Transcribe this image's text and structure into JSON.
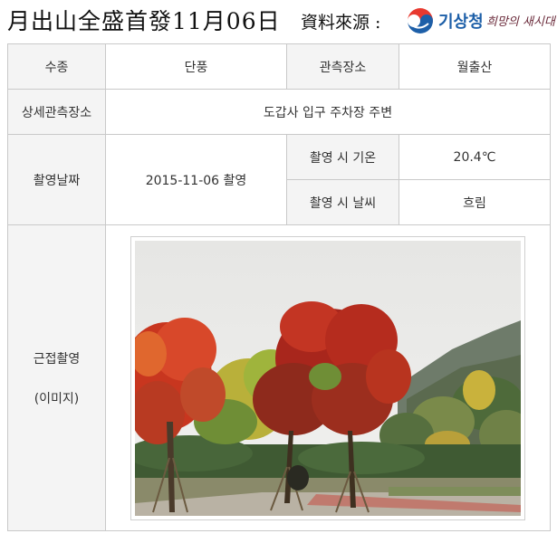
{
  "header": {
    "title": "月出山全盛首發11月06日",
    "source_label": "資料來源 :",
    "agency_name": "기상청",
    "slogan": "희망의 새시대"
  },
  "table": {
    "species_label": "수종",
    "species_value": "단풍",
    "location_label": "관측장소",
    "location_value": "월출산",
    "detail_location_label": "상세관측장소",
    "detail_location_value": "도갑사 입구 주차장 주변",
    "date_label": "촬영날짜",
    "date_value": "2015-11-06 촬영",
    "temp_label": "촬영 시 기온",
    "temp_value": "20.4℃",
    "weather_label": "촬영 시 날씨",
    "weather_value": "흐림",
    "photo_label": "근접촬영",
    "photo_sublabel": "(이미지)"
  },
  "colors": {
    "border": "#c9c9c9",
    "label_bg": "#f4f4f4",
    "agency_blue": "#1d5fa8"
  },
  "icons": {
    "logo": "kma-logo-icon"
  }
}
